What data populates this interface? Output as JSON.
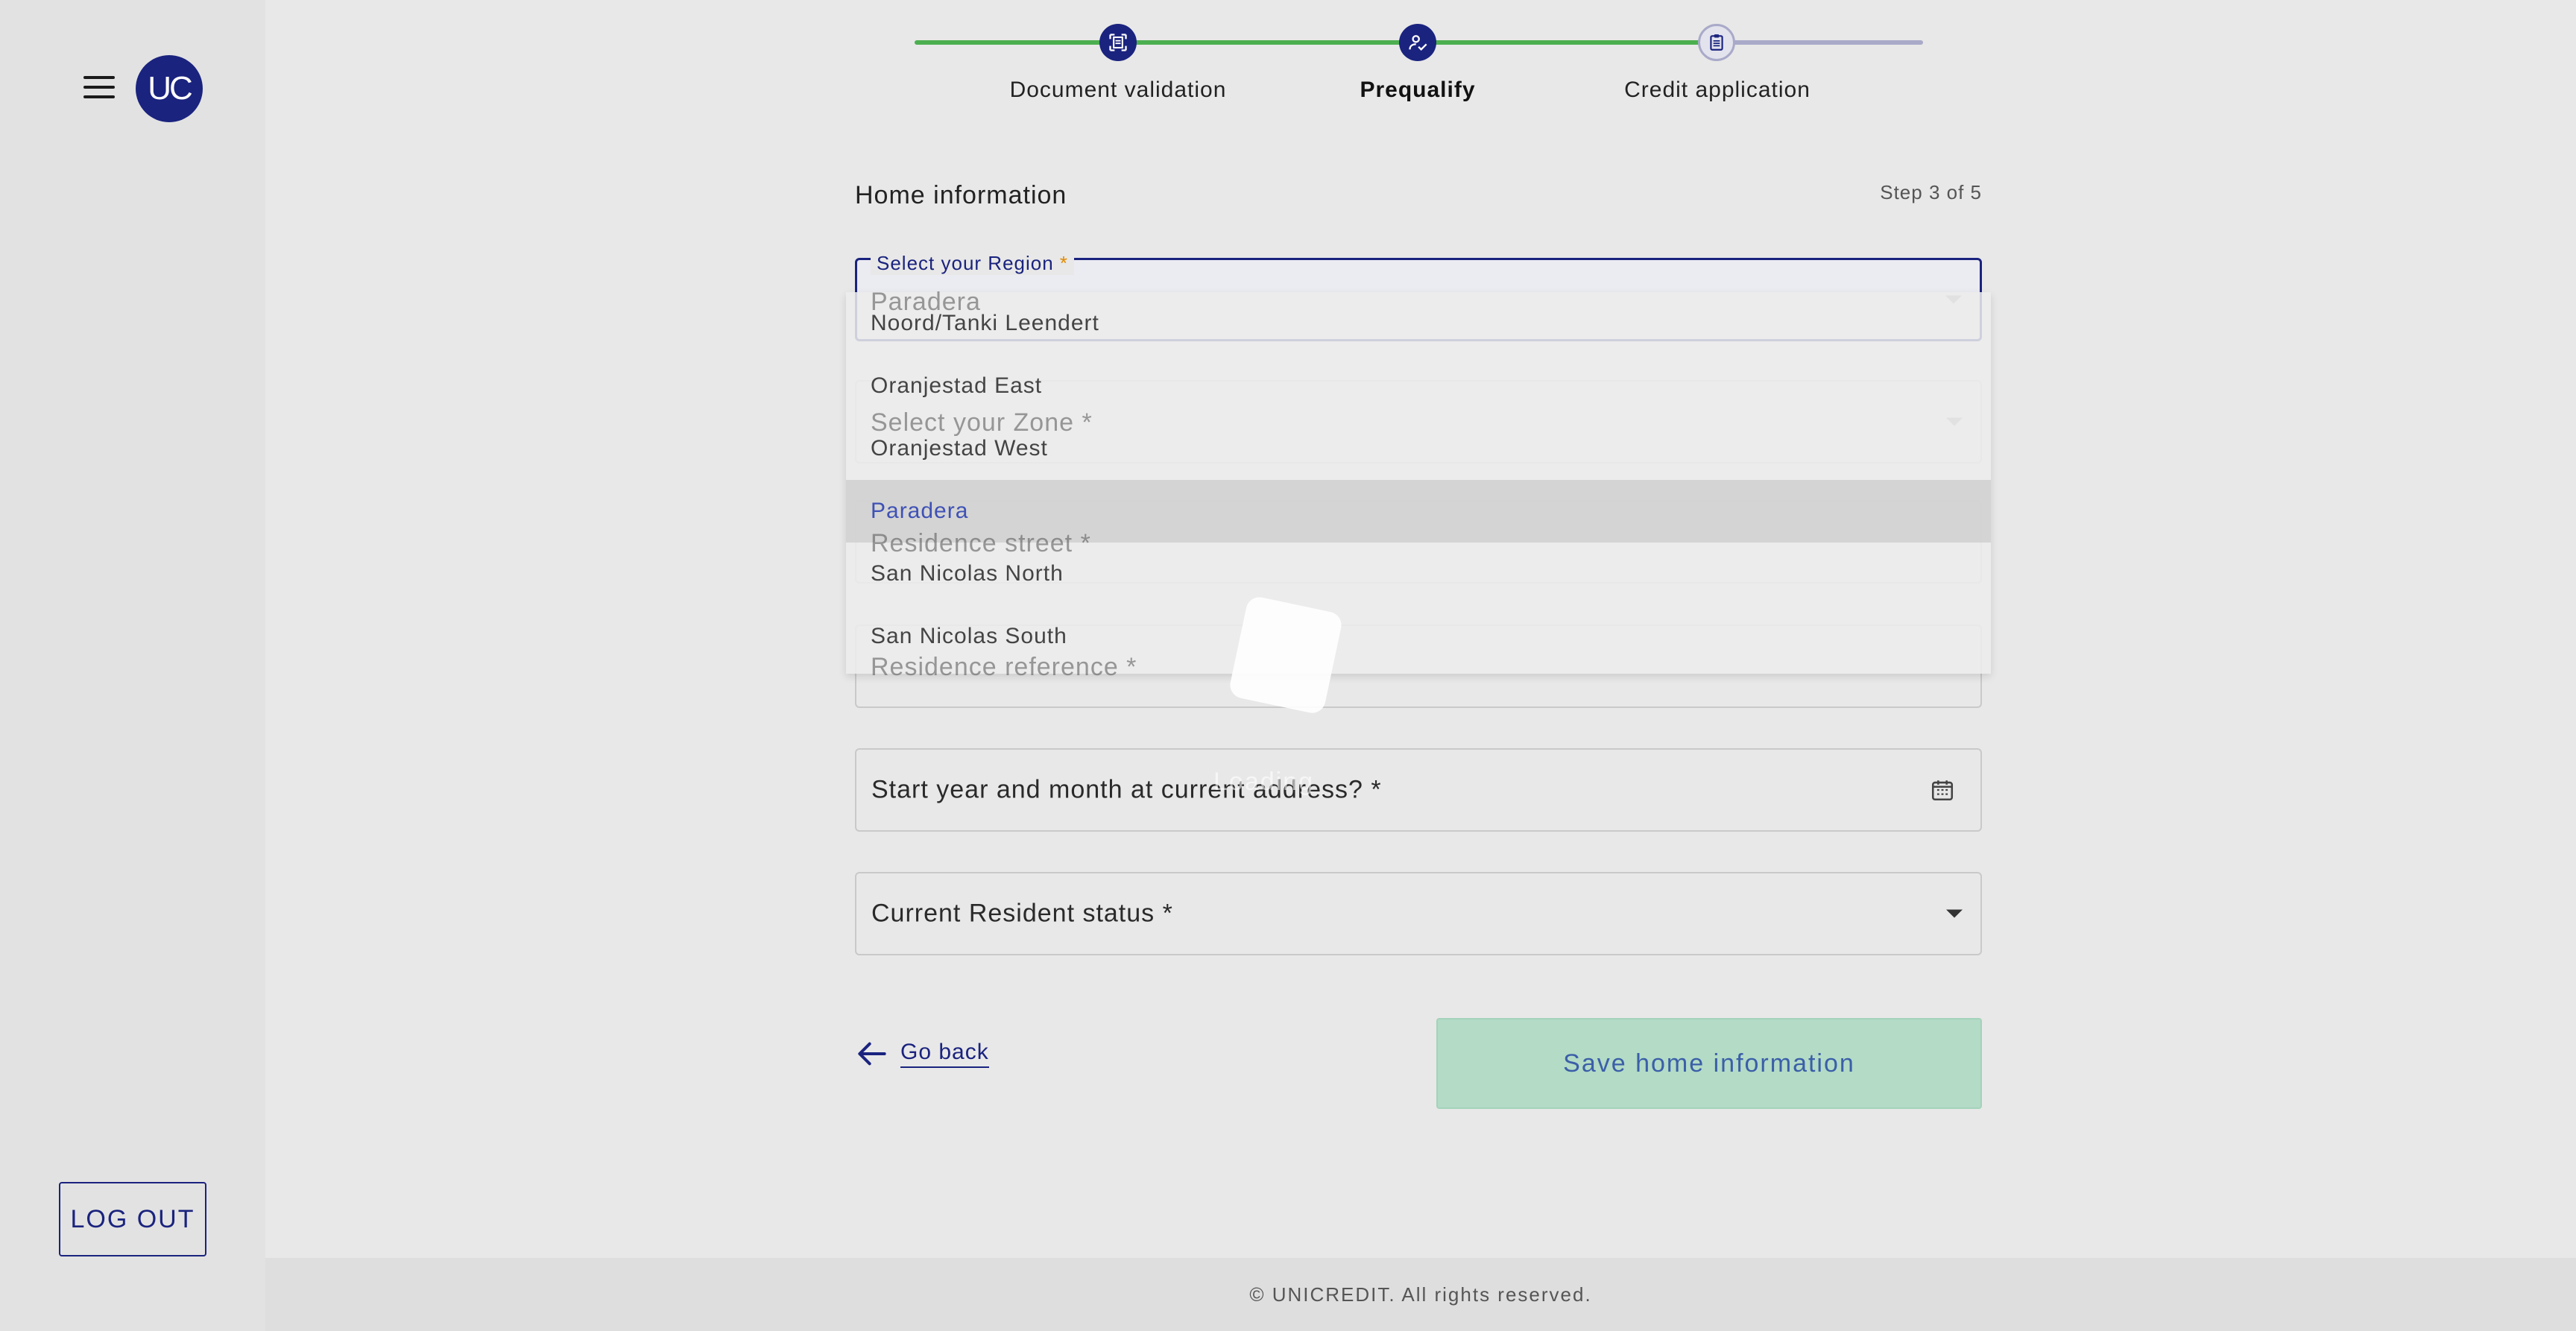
{
  "sidebar": {
    "avatar_initials": "UC",
    "logout_label": "LOG OUT"
  },
  "stepper": {
    "steps": [
      {
        "label": "Document validation",
        "icon": "document-scan-icon"
      },
      {
        "label": "Prequalify",
        "icon": "user-check-icon"
      },
      {
        "label": "Credit application",
        "icon": "clipboard-icon"
      }
    ],
    "colors": {
      "done": "#4caf50",
      "pending": "#a9a9c9",
      "node": "#1a237e"
    }
  },
  "form": {
    "title": "Home information",
    "step_count": "Step 3 of 5",
    "region": {
      "label": "Select your Region",
      "required_marker": "*",
      "value": "Paradera",
      "options": [
        "Noord/Tanki Leendert",
        "Oranjestad East",
        "Oranjestad West",
        "Paradera",
        "San Nicolas North",
        "San Nicolas South"
      ],
      "selected_index": 3
    },
    "zone_placeholder": "Select your Zone *",
    "street_placeholder": "Residence street *",
    "reference_placeholder": "Residence reference *",
    "start_date_placeholder": "Start year and month at current address? *",
    "resident_status_placeholder": "Current Resident status *",
    "loading_text": "Loading"
  },
  "actions": {
    "go_back_label": "Go back",
    "save_label": "Save home information"
  },
  "footer": {
    "copyright": "© UNICREDIT. All rights reserved."
  },
  "colors": {
    "primary": "#1a237e",
    "success": "#4caf50",
    "save_button_bg": "#b3dbc6"
  }
}
